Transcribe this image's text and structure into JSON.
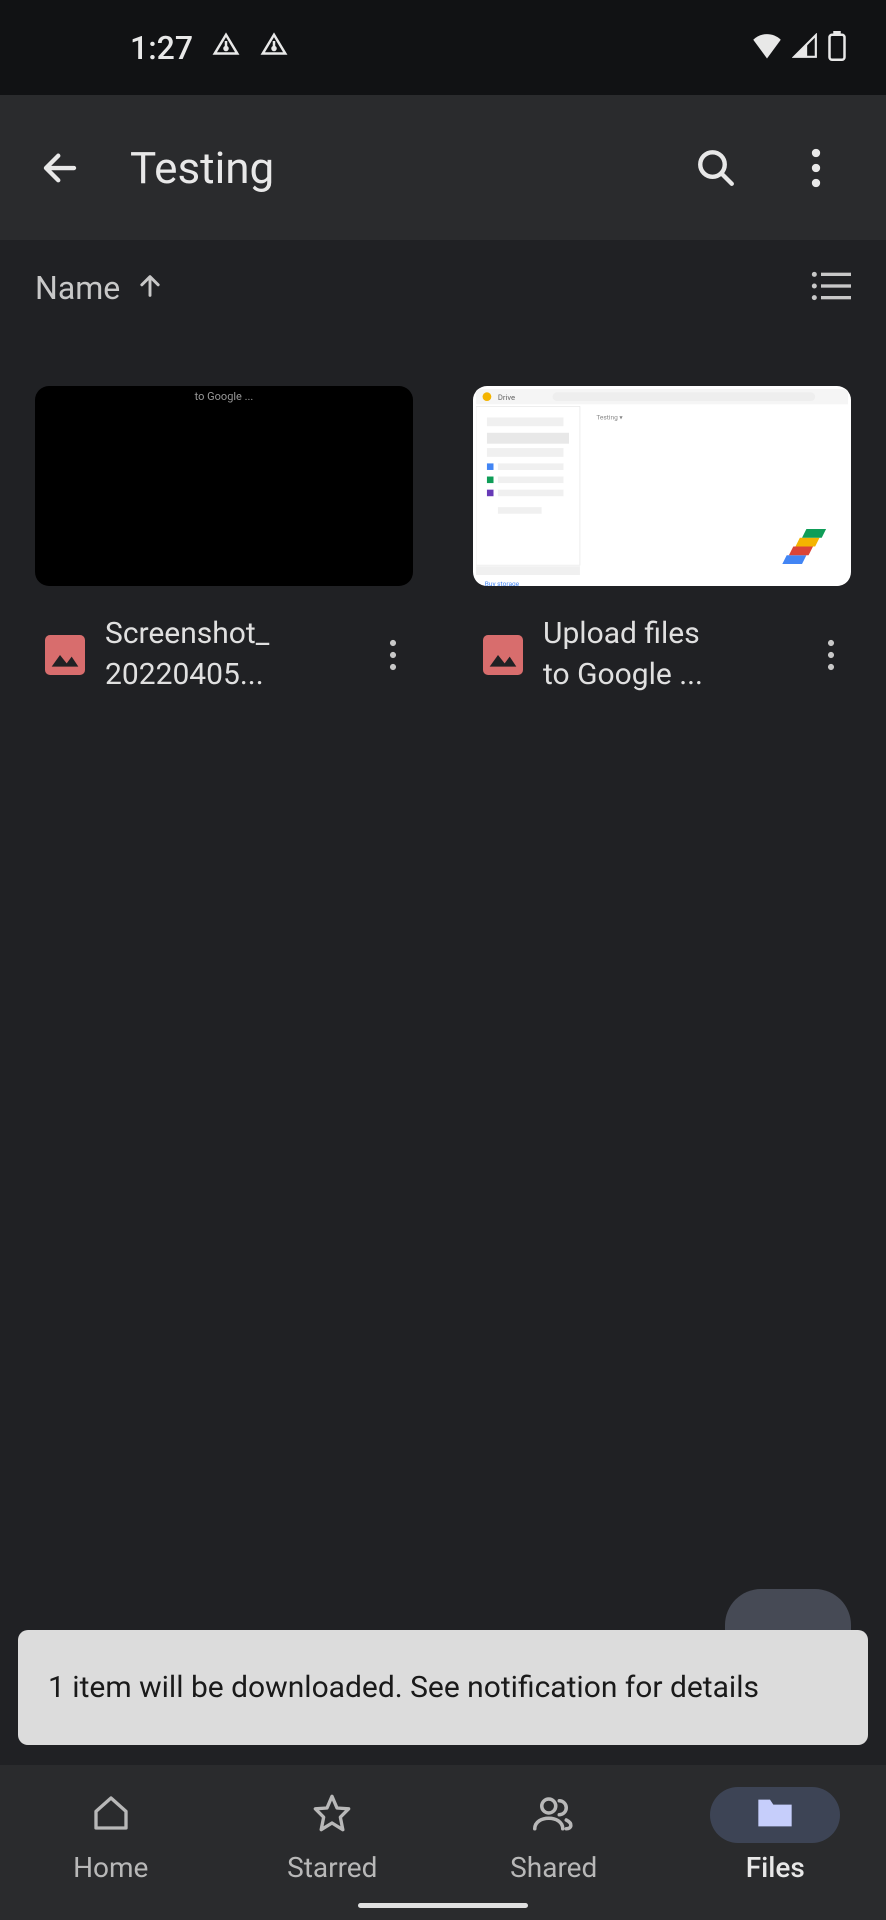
{
  "status": {
    "time": "1:27"
  },
  "header": {
    "title": "Testing"
  },
  "sort": {
    "label": "Name"
  },
  "files": [
    {
      "name_line1": "Screenshot_",
      "name_line2": "20220405...",
      "thumb_text": "to Google ..."
    },
    {
      "name_line1": "Upload files",
      "name_line2": "to Google ..."
    }
  ],
  "snackbar": {
    "message": "1 item will be downloaded. See notification for details"
  },
  "nav": {
    "items": [
      {
        "label": "Home"
      },
      {
        "label": "Starred"
      },
      {
        "label": "Shared"
      },
      {
        "label": "Files"
      }
    ]
  }
}
